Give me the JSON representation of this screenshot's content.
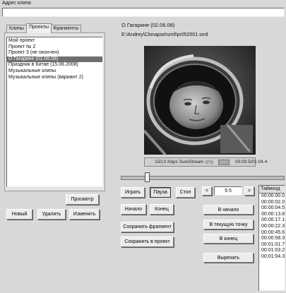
{
  "address": {
    "label": "Адрес клипа",
    "value": ""
  },
  "tabs": [
    {
      "label": "Клипы"
    },
    {
      "label": "Проекты"
    },
    {
      "label": "Фрагменты"
    }
  ],
  "projects": [
    {
      "label": "Мой проект"
    },
    {
      "label": "Проект № 2"
    },
    {
      "label": "Проект 3 (не окончен)"
    },
    {
      "label": "О Гагарине (02.06.08)"
    },
    {
      "label": "Праздник в Китае (15.06.2008)"
    },
    {
      "label": "Музыкальные клипы"
    },
    {
      "label": "Музыкальные клипы (вариант 2)"
    }
  ],
  "left_buttons": {
    "preview": "Просмотр",
    "new": "Новый",
    "delete": "Удалить",
    "edit": "Изменить"
  },
  "clip": {
    "title": "О Гагарине (02.06.08)",
    "path": "E:\\Andrey\\Clonapse\\smil\\pr052001.smil"
  },
  "player": {
    "stream_label": "150,0 Kbps SureStream",
    "time": "00:09.5/01:04.4",
    "position": 0.15
  },
  "controls": {
    "play": "Играть",
    "pause": "Пауза",
    "stop": "Стоп",
    "prev": "<",
    "step_value": "9.5",
    "next": ">",
    "start": "Начало",
    "end": "Конец",
    "save_fragment": "Сохранить фрагмент",
    "save_to_project": "Сохранить в проект",
    "to_start": "В начало",
    "to_current": "В текущую точку",
    "to_end": "В конец",
    "cut": "Вырезать"
  },
  "timecodes": {
    "header": "Таймкод",
    "items": [
      "00:00:00.0",
      "00:00:02.0",
      "00:00:04.5",
      "00:00:13.8",
      "00:00:17.1",
      "00:00:22.3",
      "00:00:45.6",
      "00:00:58.3",
      "00:01:01.7",
      "00:01:03.2",
      "00:01:04.3"
    ]
  }
}
